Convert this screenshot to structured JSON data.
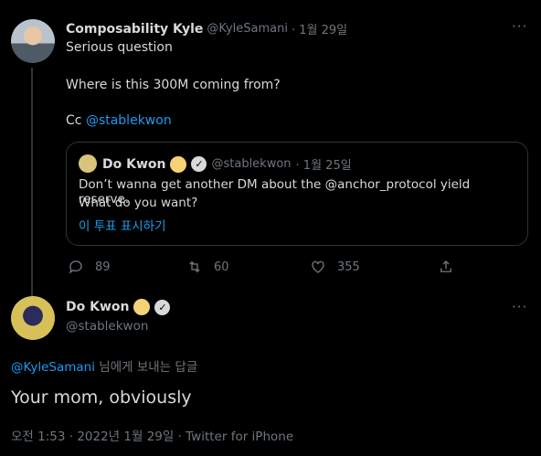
{
  "tweet": {
    "author_name": "Composability Kyle",
    "author_handle": "@KyleSamani",
    "date": "· 1월 29일",
    "line1": "Serious question",
    "line2": "Where is this 300M coming from?",
    "cc_prefix": "Cc ",
    "cc_mention": "@stablekwon",
    "quote": {
      "name": "Do Kwon",
      "handle": "@stablekwon",
      "date": "· 1월 25일",
      "text1": "Don’t wanna get another DM about the @anchor_protocol yield reserve.",
      "text2": "What do you want?",
      "poll_link": "이 투표 표시하기"
    },
    "actions": {
      "replies": "89",
      "retweets": "60",
      "likes": "355"
    }
  },
  "reply": {
    "name": "Do Kwon",
    "handle": "@stablekwon",
    "replying_mention": "@KyleSamani",
    "replying_suffix": " 님에게 보내는 답글",
    "text": "Your mom, obviously",
    "meta": "오전 1:53 · 2022년 1월 29일 · Twitter for iPhone"
  },
  "colors": {
    "background": "#000000",
    "text": "#d9d9d9",
    "muted": "#6e767d",
    "accent": "#1d9bf0",
    "border": "#2f3336"
  }
}
